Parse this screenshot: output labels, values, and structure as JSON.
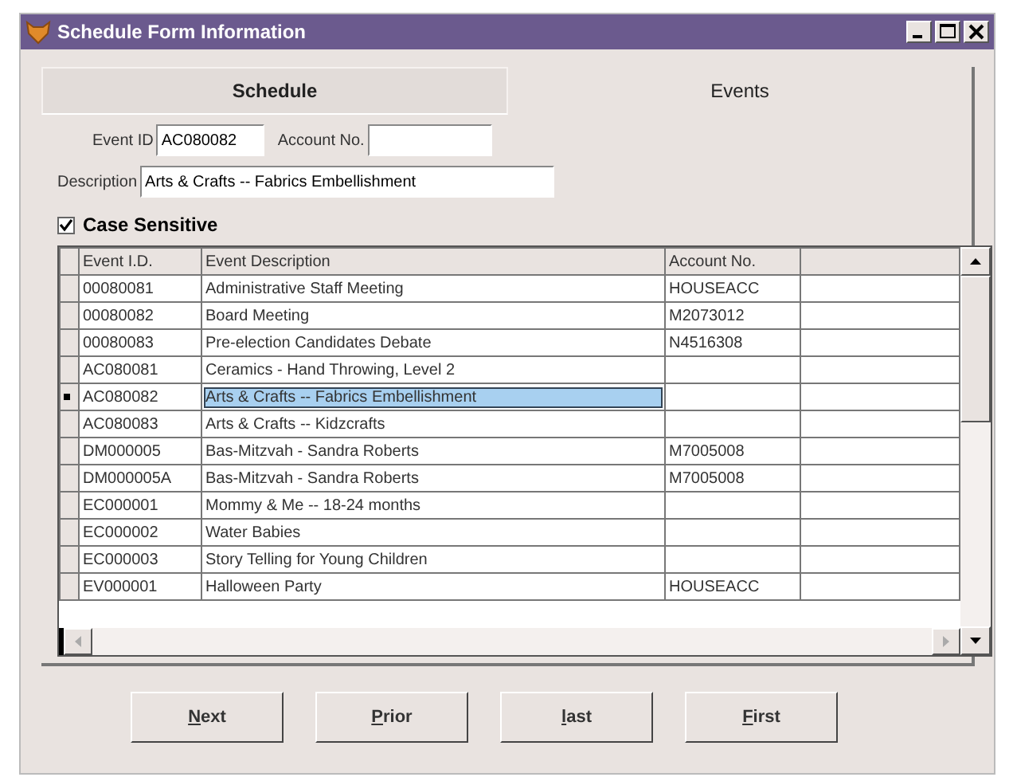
{
  "window": {
    "title": "Schedule Form Information"
  },
  "tabs": [
    {
      "label": "Schedule",
      "selected": false
    },
    {
      "label": "Events",
      "selected": true
    }
  ],
  "fields": {
    "event_id": {
      "label": "Event ID",
      "value": "AC080082"
    },
    "account_no": {
      "label": "Account No."
    },
    "description": {
      "label": "Description",
      "value": "Arts & Crafts -- Fabrics Embellishment"
    }
  },
  "case_sensitive": {
    "label": "Case Sensitive",
    "checked": true
  },
  "table": {
    "columns": [
      "Event I.D.",
      "Event Description",
      "Account No."
    ],
    "rows": [
      {
        "cells": [
          "00080081",
          "Administrative Staff Meeting",
          "HOUSEACC"
        ],
        "selected": false
      },
      {
        "cells": [
          "00080082",
          "Board Meeting",
          "M2073012"
        ],
        "selected": false
      },
      {
        "cells": [
          "00080083",
          "Pre-election Candidates Debate",
          "N4516308"
        ],
        "selected": false
      },
      {
        "cells": [
          "AC080081",
          "Ceramics - Hand Throwing, Level 2",
          ""
        ],
        "selected": false
      },
      {
        "cells": [
          "AC080082",
          "Arts & Crafts -- Fabrics Embellishment",
          ""
        ],
        "selected": true
      },
      {
        "cells": [
          "AC080083",
          "Arts & Crafts -- Kidzcrafts",
          ""
        ],
        "selected": false
      },
      {
        "cells": [
          "DM000005",
          "Bas-Mitzvah - Sandra Roberts",
          "M7005008"
        ],
        "selected": false
      },
      {
        "cells": [
          "DM000005A",
          "Bas-Mitzvah - Sandra Roberts",
          "M7005008"
        ],
        "selected": false
      },
      {
        "cells": [
          "EC000001",
          "Mommy & Me -- 18-24 months",
          ""
        ],
        "selected": false
      },
      {
        "cells": [
          "EC000002",
          "Water Babies",
          ""
        ],
        "selected": false
      },
      {
        "cells": [
          "EC000003",
          "Story Telling for Young Children",
          ""
        ],
        "selected": false
      },
      {
        "cells": [
          "EV000001",
          "Halloween Party",
          "HOUSEACC"
        ],
        "selected": false
      }
    ]
  },
  "buttons": [
    "Next",
    "Prior",
    "last",
    "First"
  ]
}
